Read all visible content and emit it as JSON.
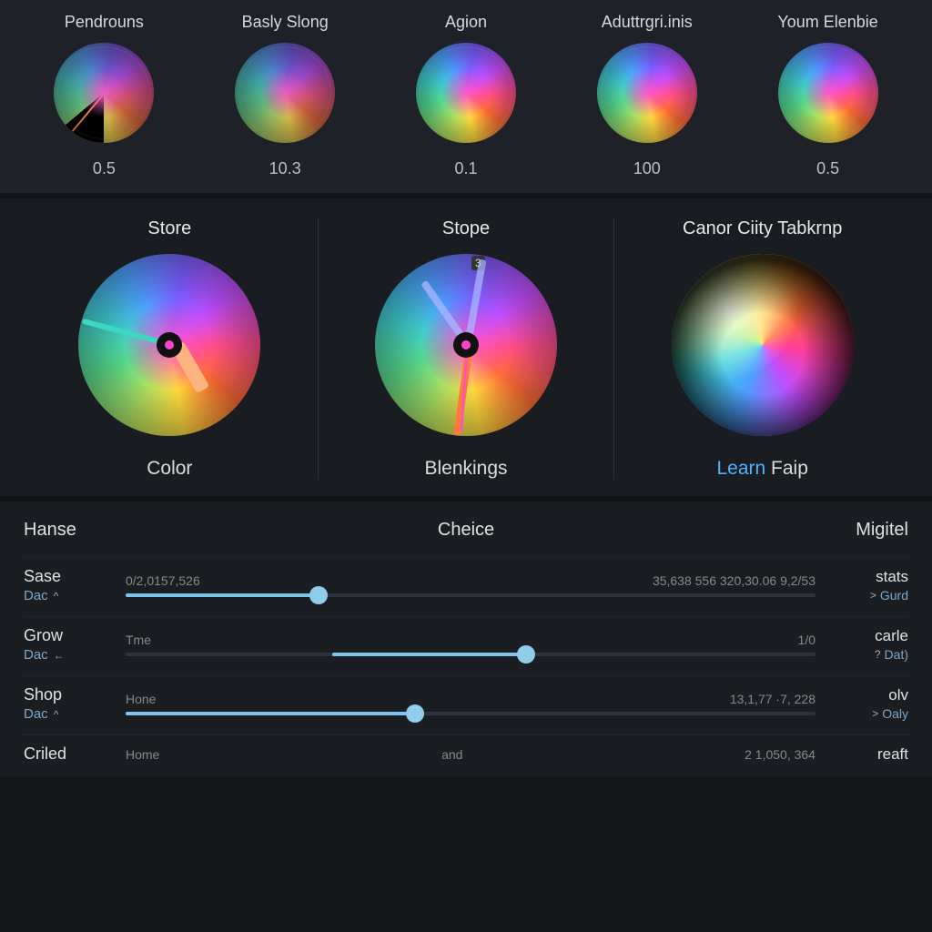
{
  "top_dials": [
    {
      "label": "Pendrouns",
      "value": "0.5"
    },
    {
      "label": "Basly Slong",
      "value": "10.3"
    },
    {
      "label": "Agion",
      "value": "0.1"
    },
    {
      "label": "Aduttrgri.inis",
      "value": "100"
    },
    {
      "label": "Youm Elenbie",
      "value": "0.5"
    }
  ],
  "mid": {
    "col1": {
      "title": "Store",
      "footer": "Color"
    },
    "col2": {
      "title": "Stope",
      "footer": "Blenkings",
      "badge": "3"
    },
    "col3": {
      "title": "Canor Ciity Tabkrnp",
      "footer_link": "Learn",
      "footer_rest": " Faip"
    }
  },
  "bottom": {
    "head_left": "Hanse",
    "head_center": "Cheice",
    "head_right": "Migitel",
    "rows": [
      {
        "left": {
          "name": "Sase",
          "sub": "Dac",
          "chev": "^"
        },
        "track": {
          "left_label": "0/2,0157,526",
          "right_label": "35,638 556  320,30.06 9,2/53",
          "fill_pct": 28,
          "thumb_pct": 28
        },
        "right": {
          "name": "stats",
          "sub": "Gurd",
          "chev": ">"
        }
      },
      {
        "left": {
          "name": "Grow",
          "sub": "Dac",
          "chev": "←"
        },
        "track": {
          "left_label": "Tme",
          "right_label": "1/0",
          "fill_start": 30,
          "fill_end": 58,
          "thumb_pct": 58
        },
        "right": {
          "name": "carle",
          "sub": "Dat)",
          "chev": "?"
        }
      },
      {
        "left": {
          "name": "Shop",
          "sub": "Dac",
          "chev": "^"
        },
        "track": {
          "left_label": "Hone",
          "right_label": "13,1,77 ·7, 228",
          "fill_pct": 42,
          "thumb_pct": 42
        },
        "right": {
          "name": "olv",
          "sub": "Oaly",
          "chev": ">"
        }
      },
      {
        "left": {
          "name": "Criled",
          "sub": "",
          "chev": ""
        },
        "track": {
          "left_label": "Home",
          "center_label": "and",
          "right_label": "2 1,050, 364",
          "fill_pct": 0,
          "thumb_pct": null
        },
        "right": {
          "name": "reaft",
          "sub": "",
          "chev": ""
        }
      }
    ]
  }
}
